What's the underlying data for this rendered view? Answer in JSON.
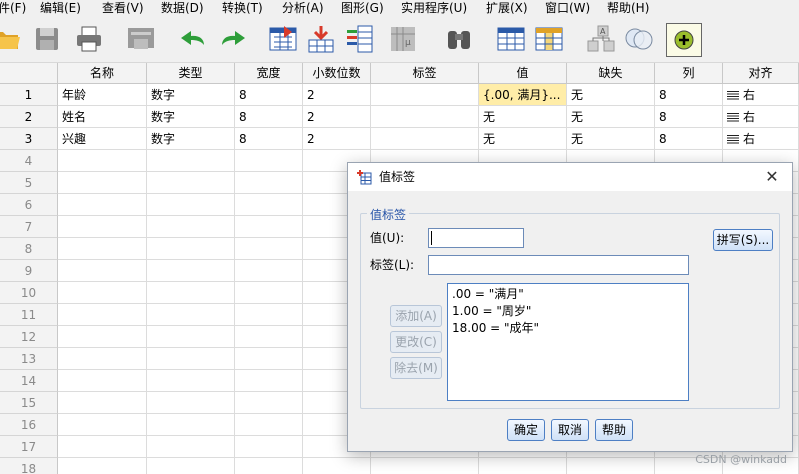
{
  "menu": [
    {
      "id": "file",
      "label": "件(F)"
    },
    {
      "id": "edit",
      "label": "编辑(E)"
    },
    {
      "id": "view",
      "label": "查看(V)"
    },
    {
      "id": "data",
      "label": "数据(D)"
    },
    {
      "id": "transform",
      "label": "转换(T)"
    },
    {
      "id": "analyze",
      "label": "分析(A)"
    },
    {
      "id": "graphs",
      "label": "图形(G)"
    },
    {
      "id": "utilities",
      "label": "实用程序(U)"
    },
    {
      "id": "extensions",
      "label": "扩展(X)"
    },
    {
      "id": "window",
      "label": "窗口(W)"
    },
    {
      "id": "help",
      "label": "帮助(H)"
    }
  ],
  "grid": {
    "headers": [
      "名称",
      "类型",
      "宽度",
      "小数位数",
      "标签",
      "值",
      "缺失",
      "列",
      "对齐"
    ],
    "rows": [
      {
        "num": "1",
        "cells": [
          "年龄",
          "数字",
          "8",
          "2",
          "",
          "{.00, 满月}...",
          "无",
          "8",
          "右"
        ]
      },
      {
        "num": "2",
        "cells": [
          "姓名",
          "数字",
          "8",
          "2",
          "",
          "无",
          "无",
          "8",
          "右"
        ]
      },
      {
        "num": "3",
        "cells": [
          "兴趣",
          "数字",
          "8",
          "2",
          "",
          "无",
          "无",
          "8",
          "右"
        ]
      }
    ],
    "empty_row_numbers": [
      "4",
      "5",
      "6",
      "7",
      "8",
      "9",
      "10",
      "11",
      "12",
      "13",
      "14",
      "15",
      "16",
      "17",
      "18"
    ]
  },
  "dialog": {
    "title": "值标签",
    "group_title": "值标签",
    "value_label": "值(U):",
    "value_input": "",
    "label_label": "标签(L):",
    "label_input": "",
    "spelling_button": "拼写(S)...",
    "add_button": "添加(A)",
    "change_button": "更改(C)",
    "remove_button": "除去(M)",
    "list_items": [
      ".00 = \"满月\"",
      "1.00 = \"周岁\"",
      "18.00 = \"成年\""
    ],
    "ok_button": "确定",
    "cancel_button": "取消",
    "help_button": "帮助"
  },
  "watermark": "CSDN @winkadd",
  "colors": {
    "highlight_cell": "#ffeda8",
    "accent_blue": "#4d7fc4"
  }
}
